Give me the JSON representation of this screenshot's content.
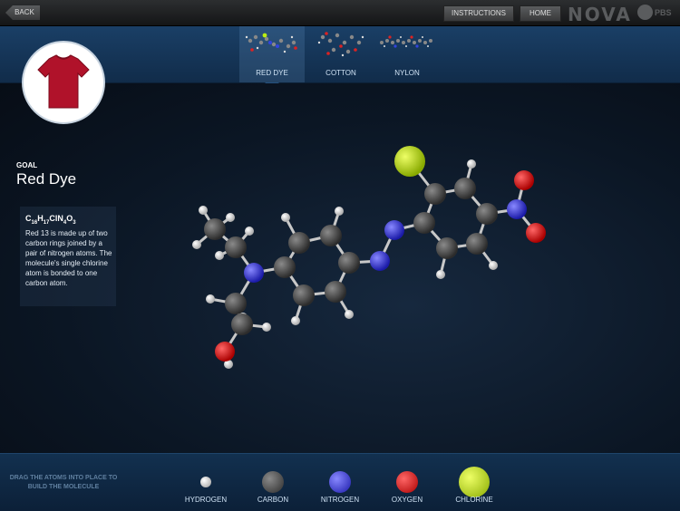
{
  "topbar": {
    "back_label": "BACK",
    "instructions_label": "INSTRUCTIONS",
    "home_label": "HOME",
    "logo_text": "NOVA",
    "pbs_text": "PBS"
  },
  "tabs": [
    {
      "label": "RED DYE",
      "active": true
    },
    {
      "label": "COTTON",
      "active": false
    },
    {
      "label": "NYLON",
      "active": false
    }
  ],
  "goal": {
    "label": "GOAL",
    "title": "Red Dye",
    "formula": {
      "c": "C",
      "c_n": "16",
      "h": "H",
      "h_n": "17",
      "cl": "Cl",
      "n": "N",
      "n_n": "4",
      "o": "O",
      "o_n": "3"
    },
    "description": "Red 13 is made up of two carbon rings joined by a pair of nitrogen atoms. The molecule's single chlorine atom is bonded to one carbon atom."
  },
  "bottom": {
    "instruction": "DRAG THE ATOMS INTO PLACE TO BUILD THE MOLECULE",
    "atoms": [
      {
        "label": "HYDROGEN",
        "color": "#ffffff"
      },
      {
        "label": "CARBON",
        "color": "#4a4a4a"
      },
      {
        "label": "NITROGEN",
        "color": "#3333dd"
      },
      {
        "label": "OXYGEN",
        "color": "#dd1111"
      },
      {
        "label": "CHLORINE",
        "color": "#bbee11"
      }
    ]
  },
  "colors": {
    "accent": "#1a3f66",
    "shirt": "#b0122a"
  }
}
